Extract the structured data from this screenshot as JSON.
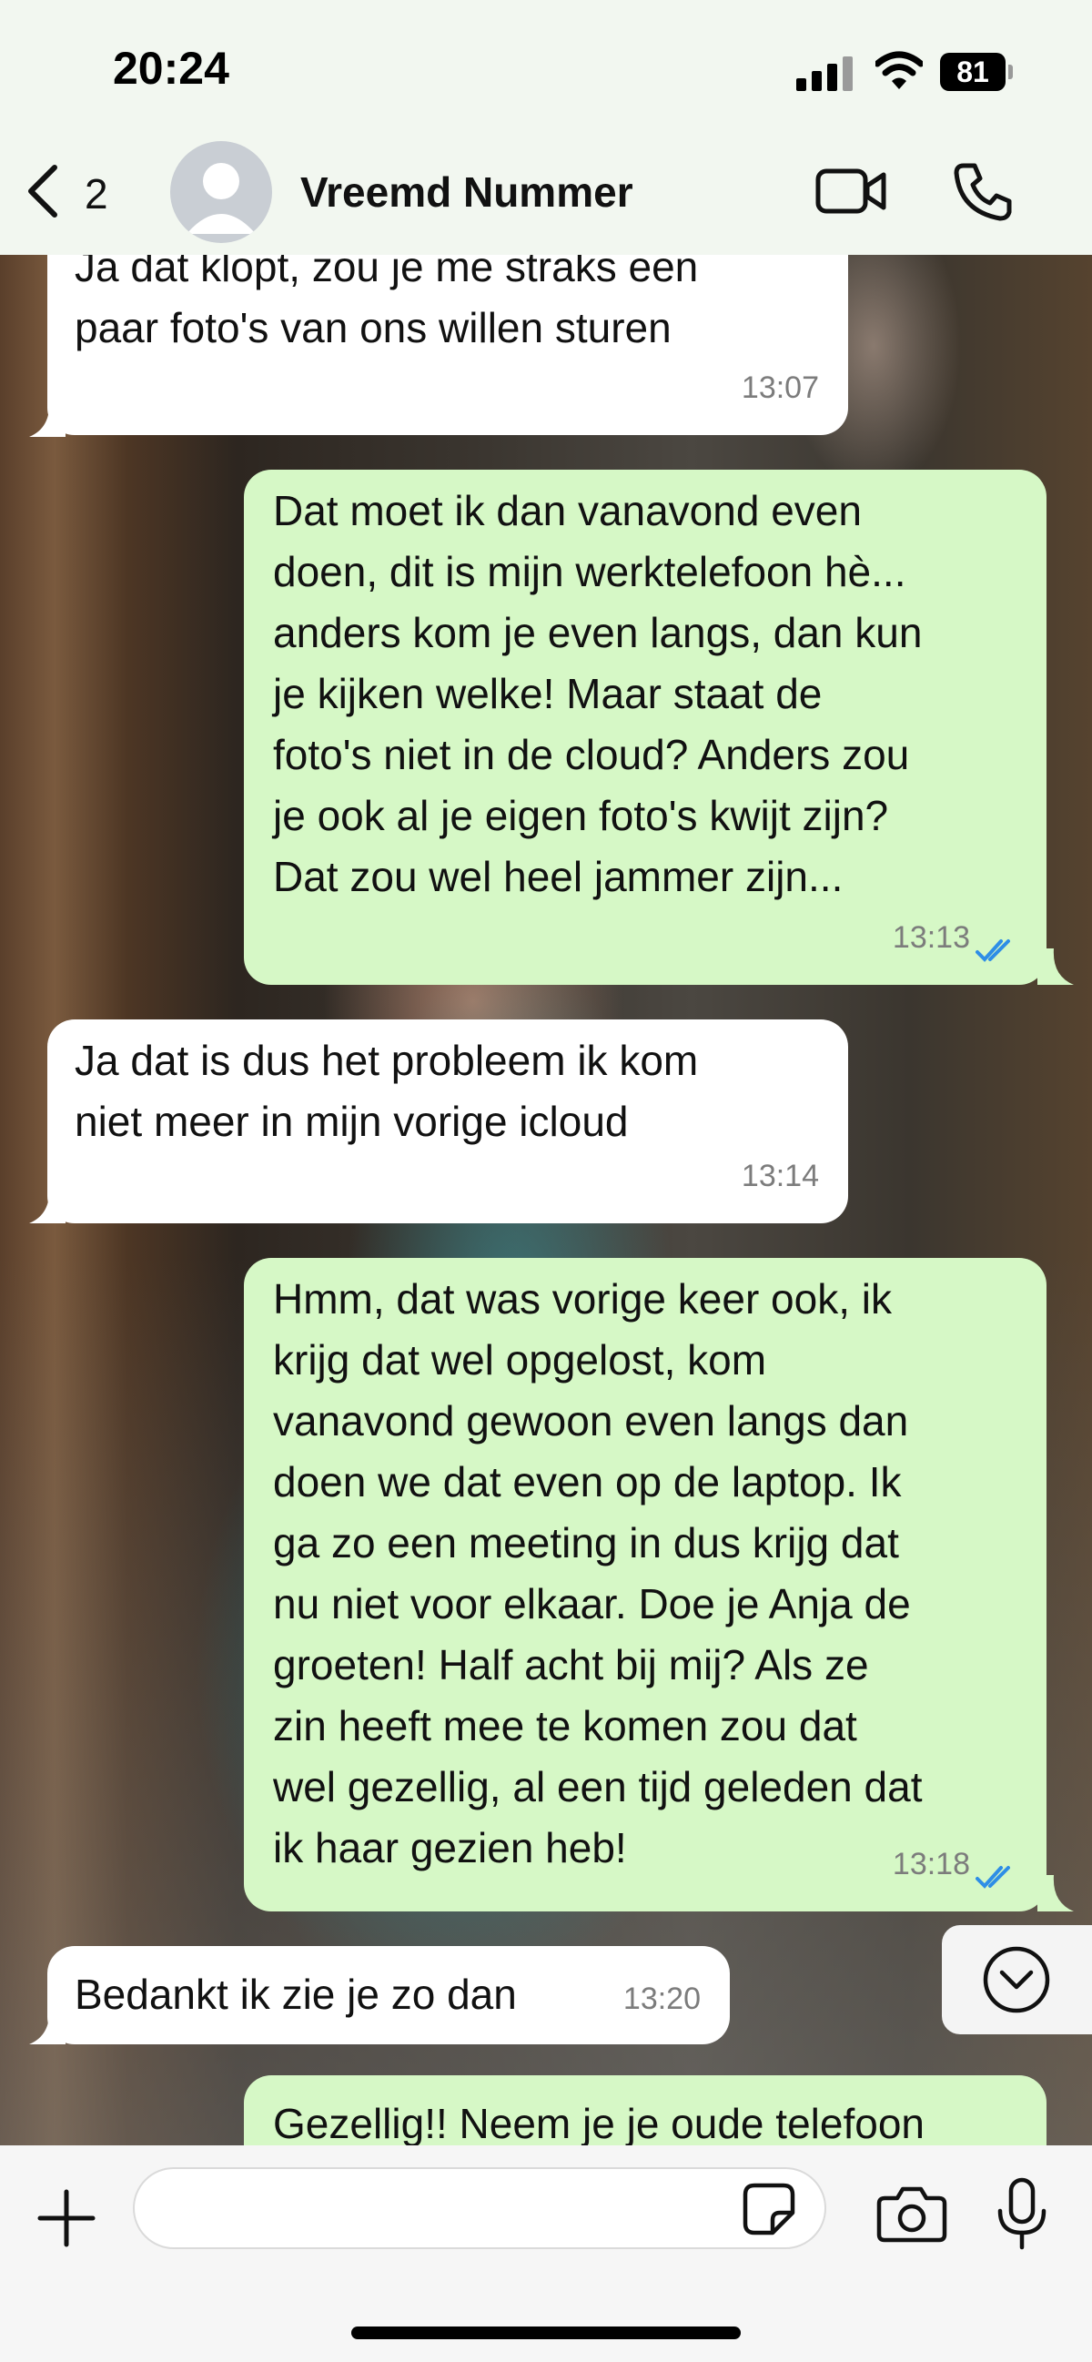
{
  "status_bar": {
    "time": "20:24",
    "battery": "81"
  },
  "header": {
    "back_count": "2",
    "contact_name": "Vreemd Nummer"
  },
  "messages": [
    {
      "direction": "in",
      "text": "Ja dat klopt, zou je me straks een\npaar foto's van ons willen sturen",
      "time": "13:07"
    },
    {
      "direction": "out",
      "text": "Dat moet ik dan vanavond even\ndoen, dit is mijn werktelefoon hè...\nanders kom je even langs, dan kun\nje kijken welke! Maar staat de\nfoto's niet in de cloud? Anders zou\nje ook al je eigen foto's kwijt zijn?\nDat zou wel heel jammer zijn...",
      "time": "13:13",
      "read": true
    },
    {
      "direction": "in",
      "text": "Ja dat is dus het probleem ik kom\nniet meer in mijn vorige icloud",
      "time": "13:14"
    },
    {
      "direction": "out",
      "text": "Hmm, dat was vorige keer ook, ik\nkrijg dat wel opgelost, kom\nvanavond gewoon even langs dan\ndoen we dat even op de laptop. Ik\nga zo een meeting in dus krijg dat\nnu niet voor elkaar. Doe je Anja de\ngroeten! Half acht bij mij? Als ze\nzin heeft mee te komen zou dat\nwel gezellig, al een tijd geleden dat\nik haar gezien heb!",
      "time": "13:18",
      "read": true
    },
    {
      "direction": "in",
      "text": "Bedankt ik zie je zo dan",
      "time": "13:20"
    },
    {
      "direction": "out",
      "text": "Gezellig!! Neem je je oude telefoon",
      "time": ""
    }
  ],
  "input": {
    "placeholder": ""
  },
  "colors": {
    "outgoing_bubble": "#d6f8c6",
    "incoming_bubble": "#ffffff",
    "read_ticks": "#2e8ee6",
    "header_bg": "#f2f7f0"
  },
  "icons": [
    "back-chevron-icon",
    "avatar-icon",
    "video-call-icon",
    "phone-icon",
    "scroll-down-icon",
    "plus-icon",
    "sticker-icon",
    "camera-icon",
    "microphone-icon"
  ]
}
